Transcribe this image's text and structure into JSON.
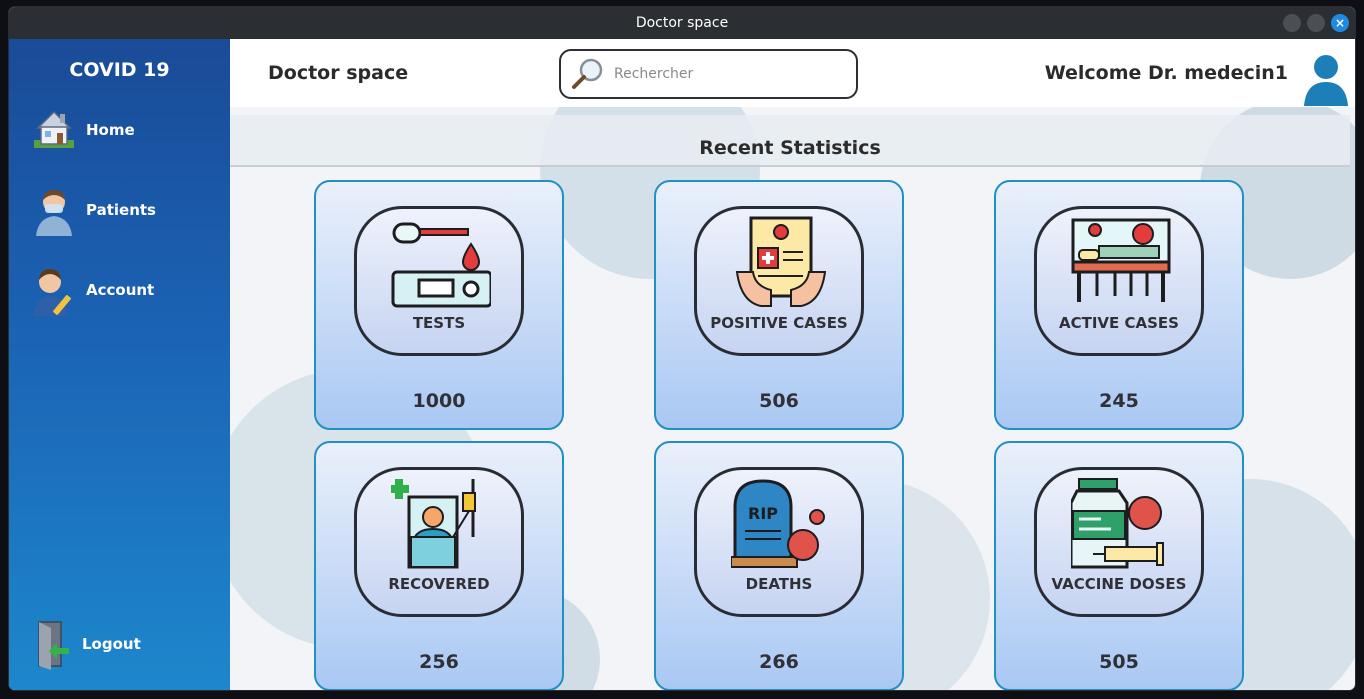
{
  "window": {
    "title": "Doctor space"
  },
  "sidebar": {
    "brand": "COVID 19",
    "items": [
      {
        "label": "Home",
        "icon": "house-icon"
      },
      {
        "label": "Patients",
        "icon": "doctor-icon"
      },
      {
        "label": "Account",
        "icon": "user-edit-icon"
      }
    ],
    "logout": {
      "label": "Logout",
      "icon": "logout-door-icon"
    }
  },
  "header": {
    "page_title": "Doctor space",
    "search_placeholder": "Rechercher",
    "search_value": "",
    "welcome": "Welcome Dr. medecin1"
  },
  "stats": {
    "title": "Recent Statistics",
    "cards": [
      {
        "label": "TESTS",
        "value": "1000",
        "icon": "test-kit-icon"
      },
      {
        "label": "POSITIVE CASES",
        "value": "506",
        "icon": "positive-report-icon"
      },
      {
        "label": "ACTIVE CASES",
        "value": "245",
        "icon": "hospital-bed-virus-icon"
      },
      {
        "label": "RECOVERED",
        "value": "256",
        "icon": "recovered-patient-icon"
      },
      {
        "label": "DEATHS",
        "value": "266",
        "icon": "tombstone-icon"
      },
      {
        "label": "VACCINE DOSES",
        "value": "505",
        "icon": "vaccine-icon"
      }
    ]
  },
  "colors": {
    "sidebar_top": "#1a4b98",
    "sidebar_bottom": "#1d87cc",
    "card_border": "#2190c2",
    "close_button": "#1e8be0",
    "avatar": "#1d7fb8"
  }
}
